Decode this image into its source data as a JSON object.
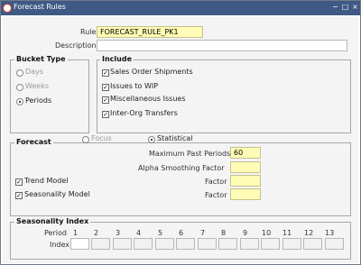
{
  "window": {
    "title": "Forecast Rules",
    "controls": [
      "−",
      "□",
      "×"
    ]
  },
  "header": {
    "rule_label": "Rule",
    "rule_value": "FORECAST_RULE_PK1",
    "description_label": "Description",
    "description_value": ""
  },
  "bucket_type": {
    "title": "Bucket Type",
    "options": [
      {
        "label": "Days",
        "selected": false
      },
      {
        "label": "Weeks",
        "selected": false
      },
      {
        "label": "Periods",
        "selected": true
      }
    ]
  },
  "include": {
    "title": "Include",
    "items": [
      {
        "label": "Sales Order Shipments",
        "checked": true
      },
      {
        "label": "Issues to WIP",
        "checked": true
      },
      {
        "label": "Miscellaneous Issues",
        "checked": true
      },
      {
        "label": "Inter-Org Transfers",
        "checked": true
      }
    ]
  },
  "forecast": {
    "title": "Forecast",
    "focus_label": "Focus",
    "statistical_label": "Statistical",
    "max_past_periods_label": "Maximum Past Periods",
    "max_past_periods_value": "60",
    "alpha_label": "Alpha Smoothing Factor",
    "trend_label": "Trend Model",
    "trend_factor_label": "Factor",
    "seasonality_label": "Seasonality Model",
    "seasonality_factor_label": "Factor"
  },
  "seasonality_index": {
    "title": "Seasonality Index",
    "period_label": "Period",
    "index_label": "Index",
    "periods": [
      "1",
      "2",
      "3",
      "4",
      "5",
      "6",
      "7",
      "8",
      "9",
      "10",
      "11",
      "12",
      "13"
    ]
  }
}
